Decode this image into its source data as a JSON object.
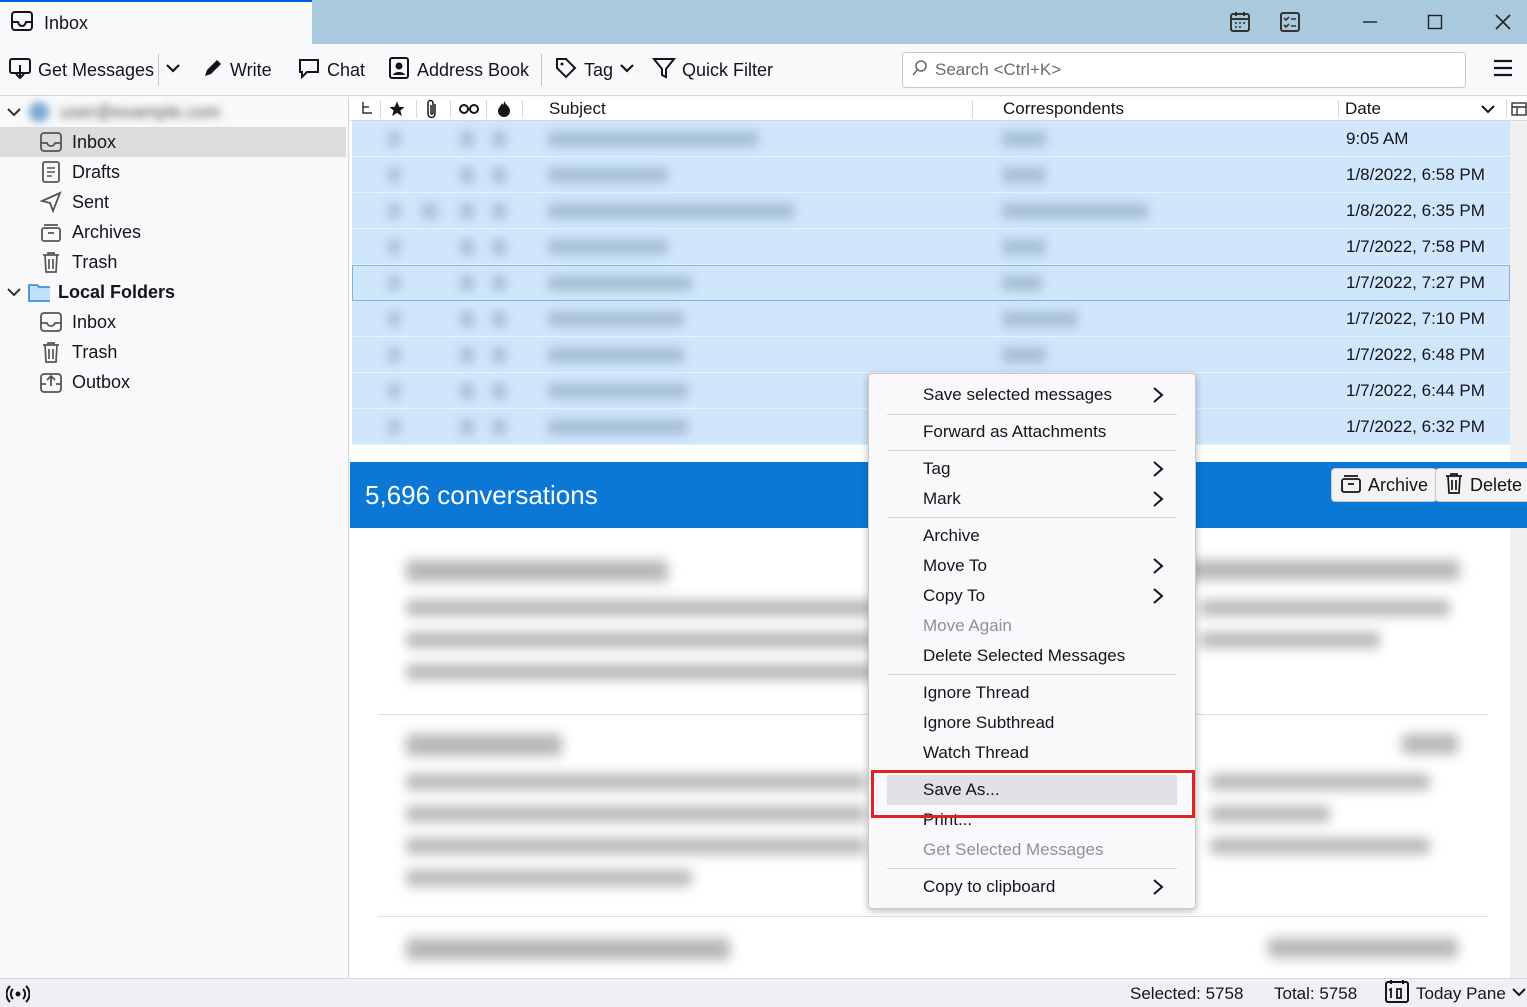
{
  "window": {
    "tab_title": "Inbox"
  },
  "toolbar": {
    "get_messages": "Get Messages",
    "write": "Write",
    "chat": "Chat",
    "address_book": "Address Book",
    "tag": "Tag",
    "quick_filter": "Quick Filter",
    "search_placeholder": "Search <Ctrl+K>"
  },
  "folders": {
    "account_label": "user@example.com",
    "account_items": [
      "Inbox",
      "Drafts",
      "Sent",
      "Archives",
      "Trash"
    ],
    "local_label": "Local Folders",
    "local_items": [
      "Inbox",
      "Trash",
      "Outbox"
    ]
  },
  "columns": {
    "subject": "Subject",
    "correspondents": "Correspondents",
    "date": "Date"
  },
  "messages": [
    {
      "date": "9:05 AM"
    },
    {
      "date": "1/8/2022, 6:58 PM"
    },
    {
      "date": "1/8/2022, 6:35 PM"
    },
    {
      "date": "1/7/2022, 7:58 PM"
    },
    {
      "date": "1/7/2022, 7:27 PM"
    },
    {
      "date": "1/7/2022, 7:10 PM"
    },
    {
      "date": "1/7/2022, 6:48 PM"
    },
    {
      "date": "1/7/2022, 6:44 PM"
    },
    {
      "date": "1/7/2022, 6:32 PM"
    }
  ],
  "summary": {
    "count_text": "5,696 conversations",
    "archive": "Archive",
    "delete": "Delete"
  },
  "context_menu": {
    "save_selected": "Save selected messages",
    "forward_attachments": "Forward as Attachments",
    "tag": "Tag",
    "mark": "Mark",
    "archive": "Archive",
    "move_to": "Move To",
    "copy_to": "Copy To",
    "move_again": "Move Again",
    "delete_selected": "Delete Selected Messages",
    "ignore_thread": "Ignore Thread",
    "ignore_subthread": "Ignore Subthread",
    "watch_thread": "Watch Thread",
    "save_as": "Save As...",
    "print": "Print...",
    "get_selected": "Get Selected Messages",
    "copy_clipboard": "Copy to clipboard"
  },
  "status": {
    "selected": "Selected: 5758",
    "total": "Total: 5758",
    "today_pane": "Today Pane"
  },
  "colors": {
    "accent": "#0a78d4",
    "selection": "#cfe6fb",
    "highlight_box": "#e02222"
  }
}
